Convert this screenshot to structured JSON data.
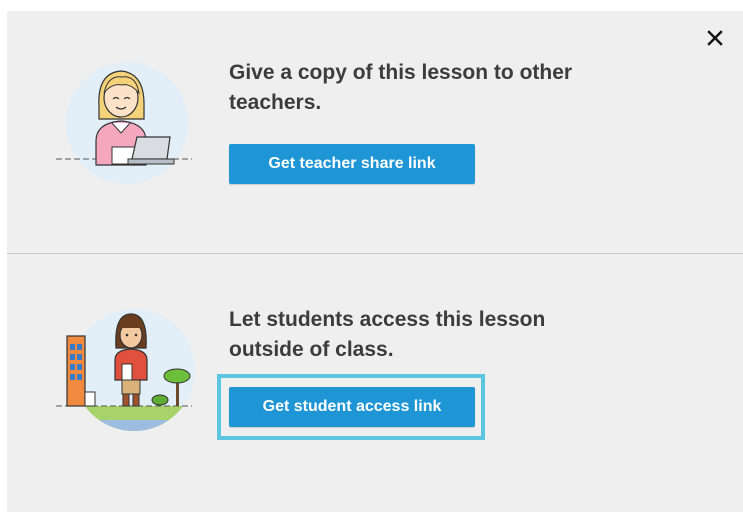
{
  "close_icon": "close-icon",
  "teacher_section": {
    "heading_line1": "Give a copy of this lesson to other",
    "heading_line2": "teachers.",
    "button_label": "Get teacher share link",
    "illustration": "teacher-laptop-illustration"
  },
  "student_section": {
    "heading_line1": "Let students access this lesson",
    "heading_line2": "outside of class.",
    "button_label": "Get student access link",
    "illustration": "student-outdoors-illustration"
  },
  "colors": {
    "button": "#1e96d6",
    "focus_ring": "#5cc6e0",
    "background": "#efefef"
  }
}
